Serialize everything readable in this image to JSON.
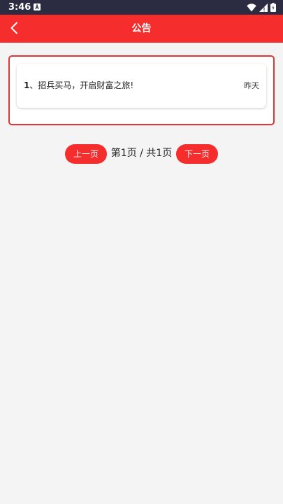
{
  "status_bar": {
    "time": "3:46",
    "icons": [
      "notification-a-icon",
      "wifi-icon",
      "signal-icon",
      "battery-icon"
    ]
  },
  "header": {
    "title": "公告",
    "back_icon": "chevron-left-icon",
    "background_color": "#f52d2d"
  },
  "notices": [
    {
      "index": "1",
      "separator": "、",
      "title": "招兵买马，开启财富之旅!",
      "date": "昨天"
    }
  ],
  "pager": {
    "prev_label": "上一页",
    "next_label": "下一页",
    "page_info": "第1页 / 共1页",
    "current_page": 1,
    "total_pages": 1,
    "accent_color": "#f52d2d"
  }
}
